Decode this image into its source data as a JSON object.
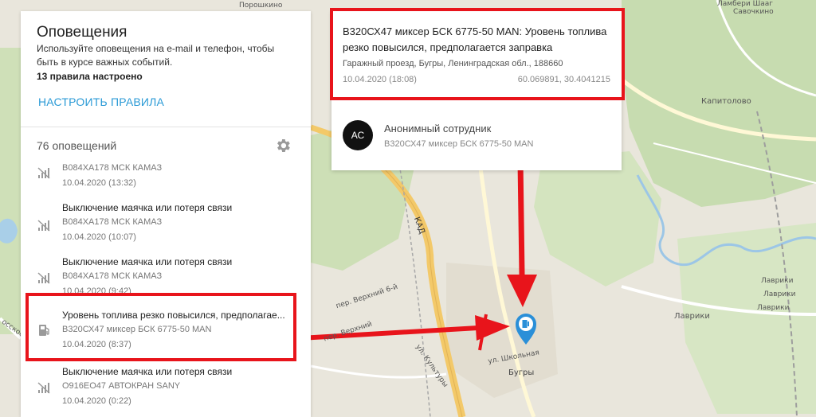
{
  "colors": {
    "accent": "#2a9ad6",
    "highlight": "#e8141b",
    "marker": "#2a8fd8",
    "panel": "#ffffff",
    "map_bg": "#e9e6dc"
  },
  "map": {
    "labels": [
      "Порошкино",
      "Ламбери Шааг",
      "Савочкино",
      "Капитолово",
      "КАД",
      "Лаврики",
      "Лаврики",
      "пер. Верхний 6-й",
      "пер. Верхний",
      "ул. Школьная",
      "ул. Культуры",
      "Бугры",
      "Лаврики",
      "Лаврики",
      "осское"
    ]
  },
  "left_panel": {
    "title": "Оповещения",
    "description": "Используйте оповещения на e-mail и телефон, чтобы быть в курсе важных событий.",
    "rules_count": "13 правила настроено",
    "configure_link": "НАСТРОИТЬ ПРАВИЛА",
    "total": "76 оповещений",
    "gear_icon": "gear-icon"
  },
  "notifications": [
    {
      "title": "",
      "vehicle": "В084ХА178 МСК КАМАЗ",
      "time": "10.04.2020 (13:32)",
      "icon": "signal-lost-icon"
    },
    {
      "title": "Выключение маячка или потеря связи",
      "vehicle": "В084ХА178 МСК КАМАЗ",
      "time": "10.04.2020 (10:07)",
      "icon": "signal-lost-icon"
    },
    {
      "title": "Выключение маячка или потеря связи",
      "vehicle": "В084ХА178 МСК КАМАЗ",
      "time": "10.04.2020 (9:42)",
      "icon": "signal-lost-icon"
    },
    {
      "title": "Уровень топлива резко повысился, предполагае...",
      "vehicle": "В320СХ47 миксер БСК 6775-50 MAN",
      "time": "10.04.2020 (8:37)",
      "icon": "fuel-pump-icon"
    },
    {
      "title": "Выключение маячка или потеря связи",
      "vehicle": "О916ЕО47 АВТОКРАН SANY",
      "time": "10.04.2020 (0:22)",
      "icon": "signal-lost-icon"
    }
  ],
  "popup": {
    "title": "В320СХ47 миксер БСК 6775-50 MAN: Уровень топлива резко повысился, предполагается заправка",
    "address": "Гаражный проезд, Бугры, Ленинградская обл., 188660",
    "time": "10.04.2020 (18:08)",
    "coords": "60.069891, 30.4041215",
    "avatar": "АС",
    "employee": "Анонимный сотрудник",
    "vehicle": "В320СХ47 миксер БСК 6775-50 MAN"
  }
}
